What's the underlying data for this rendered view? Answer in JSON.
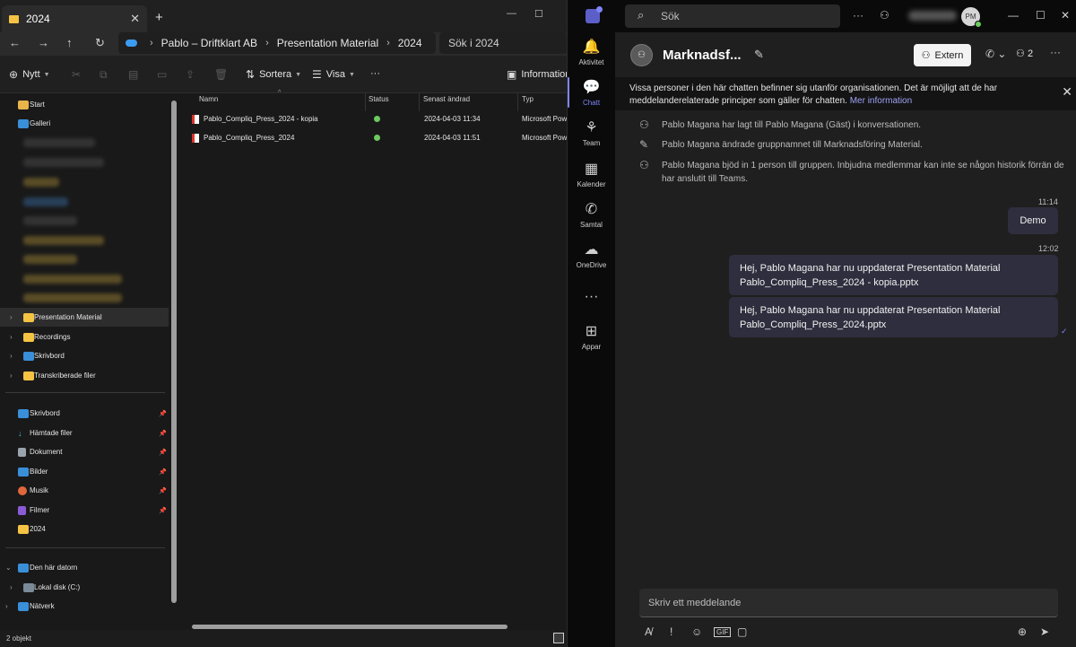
{
  "explorer": {
    "tab_title": "2024",
    "win_controls": [
      "—",
      "☐",
      "✕"
    ],
    "breadcrumb": [
      "Pablo – Driftklart AB",
      "Presentation Material",
      "2024"
    ],
    "search_placeholder": "Sök i 2024",
    "toolbar": {
      "new_label": "Nytt",
      "sort_label": "Sortera",
      "view_label": "Visa",
      "more_label": "···",
      "info_label": "Information"
    },
    "sidebar": {
      "top_items": [
        "Start",
        "Galleri"
      ],
      "folders": [
        "Presentation Material",
        "Recordings",
        "Skrivbord",
        "Transkriberade filer"
      ],
      "quick_access": [
        "Skrivbord",
        "Hämtade filer",
        "Dokument",
        "Bilder",
        "Musik",
        "Filmer",
        "2024"
      ],
      "this_pc": "Den här datorn",
      "local_disk": "Lokal disk (C:)",
      "network": "Nätverk"
    },
    "columns": [
      "Namn",
      "Status",
      "Senast ändrad",
      "Typ"
    ],
    "files": [
      {
        "name": "Pablo_Compliq_Press_2024 - kopia",
        "modified": "2024-04-03 11:34",
        "type": "Microsoft Pow"
      },
      {
        "name": "Pablo_Compliq_Press_2024",
        "modified": "2024-04-03 11:51",
        "type": "Microsoft Pow"
      }
    ],
    "status_bar": "2 objekt"
  },
  "teams": {
    "search_placeholder": "Sök",
    "avatar_initials": "PM",
    "rail": [
      "Aktivitet",
      "Chatt",
      "Team",
      "Kalender",
      "Samtal",
      "OneDrive",
      "Appar"
    ],
    "chat_title": "Marknadsf...",
    "extern_label": "Extern",
    "participants_count": "2",
    "banner_text": "Vissa personer i den här chatten befinner sig utanför organisationen. Det är möjligt att de har meddelanderelaterade principer som gäller för chatten.",
    "banner_link": "Mer information",
    "system_messages": [
      "Pablo Magana har lagt till Pablo Magana (Gäst) i konversationen.",
      "Pablo Magana ändrade gruppnamnet till Marknadsföring Material.",
      "Pablo Magana bjöd in 1 person till gruppen. Inbjudna medlemmar kan inte se någon historik förrän de har anslutit till Teams."
    ],
    "messages": [
      {
        "time": "11:14",
        "text": "Demo"
      },
      {
        "time": "12:02",
        "line1": "Hej, Pablo Magana har nu uppdaterat Presentation Material",
        "line2": "Pablo_Compliq_Press_2024 - kopia.pptx"
      },
      {
        "line1": "Hej, Pablo Magana har nu uppdaterat Presentation Material",
        "line2": "Pablo_Compliq_Press_2024.pptx"
      }
    ],
    "composer_placeholder": "Skriv ett meddelande"
  }
}
